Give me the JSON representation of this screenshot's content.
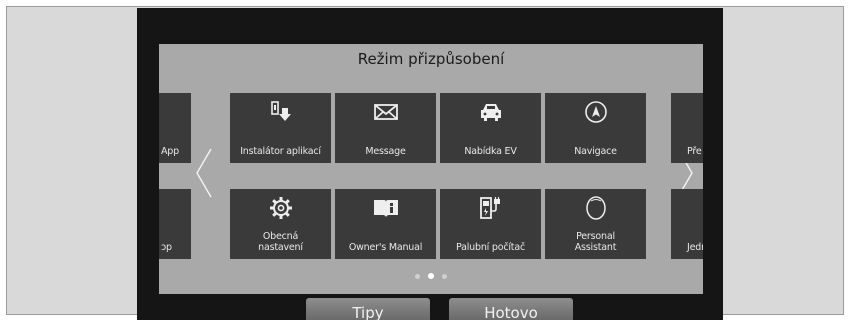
{
  "header": {
    "title": "Režim přizpůsobení"
  },
  "tiles_row1": [
    {
      "label": "Instalátor aplikací",
      "icon": "app-installer-icon"
    },
    {
      "label": "Message",
      "icon": "envelope-icon"
    },
    {
      "label": "Nabídka EV",
      "icon": "ev-car-icon"
    },
    {
      "label": "Navigace",
      "icon": "compass-icon"
    }
  ],
  "tiles_row2": [
    {
      "label": "Obecná\nnastavení",
      "icon": "gear-icon"
    },
    {
      "label": "Owner's Manual",
      "icon": "manual-book-icon"
    },
    {
      "label": "Palubní počítač",
      "icon": "fuel-charge-icon"
    },
    {
      "label": "Personal\nAssistant",
      "icon": "assistant-icon"
    }
  ],
  "edge_left": {
    "row1": "App",
    "row2": "ɔp"
  },
  "edge_right": {
    "row1": "Pře",
    "row2": "Jedr"
  },
  "pager": {
    "pages": 3,
    "active_index": 1
  },
  "buttons": {
    "tips": "Tipy",
    "done": "Hotovo"
  }
}
